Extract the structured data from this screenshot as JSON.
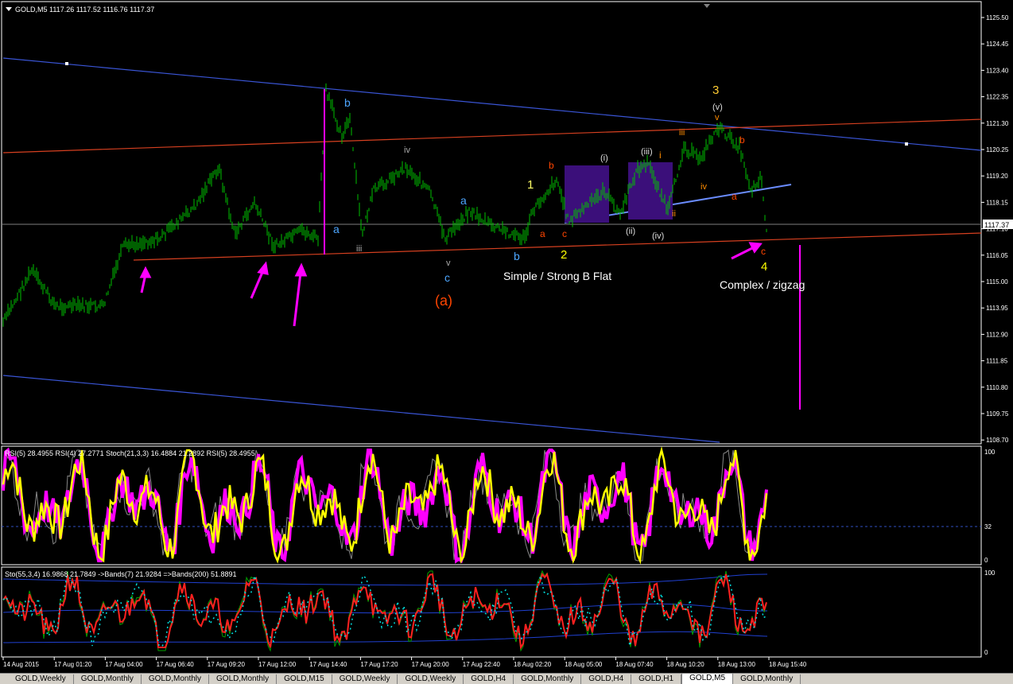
{
  "main_chart": {
    "title": "GOLD,M5  1117.26 1117.52 1116.76 1117.37",
    "current_price": "1117.37",
    "price_ticks": [
      "1125.50",
      "1124.45",
      "1123.40",
      "1122.35",
      "1121.30",
      "1120.25",
      "1119.20",
      "1118.15",
      "1117.10",
      "1116.05",
      "1115.00",
      "1113.95",
      "1112.90",
      "1111.85",
      "1110.80",
      "1109.75",
      "1108.70"
    ],
    "annotations": {
      "simple_flat": "Simple / Strong B Flat",
      "complex": "Complex / zigzag",
      "wave_a_main": "(a)",
      "w_b_top": "b",
      "w_a_left": "a",
      "w_iii_left": "iii",
      "w_iv_mid": "iv",
      "w_a_mid": "a",
      "w_v_low": "v",
      "w_c_low": "c",
      "w_b_low": "b",
      "w_1": "1",
      "w_b_red": "b",
      "w_a_red": "a",
      "w_c_red": "c",
      "w_2": "2",
      "w_i_paren": "(i)",
      "w_iii_paren": "(iii)",
      "w_i_red": "i",
      "w_ii_paren": "(ii)",
      "w_iv_paren": "(iv)",
      "w_ii_red": "ii",
      "w_3": "3",
      "w_v_paren": "(v)",
      "w_v_red": "v",
      "w_iii_red": "iii",
      "w_iv_red": "iv",
      "w_b_right": "b",
      "w_a_right": "a",
      "w_c_right": "c",
      "w_4": "4"
    }
  },
  "rsi_panel": {
    "title": "RSI(5) 28.4955  RSI(4) 27.2771  Stoch(21,3,3) 16.4884 21.2892  RSI(5) 28.4955",
    "ticks": [
      "100",
      "32",
      "0"
    ]
  },
  "sto_panel": {
    "title": "Sto(55,3,4) 16.9868 21.7849  ->Bands(7) 21.9284  =>Bands(200) 51.8891",
    "ticks": [
      "100",
      "0"
    ]
  },
  "time_axis": [
    "14 Aug 2015",
    "17 Aug 01:20",
    "17 Aug 04:00",
    "17 Aug 06:40",
    "17 Aug 09:20",
    "17 Aug 12:00",
    "17 Aug 14:40",
    "17 Aug 17:20",
    "17 Aug 20:00",
    "17 Aug 22:40",
    "18 Aug 02:20",
    "18 Aug 05:00",
    "18 Aug 07:40",
    "18 Aug 10:20",
    "18 Aug 13:00",
    "18 Aug 15:40"
  ],
  "tabs": [
    "GOLD,Weekly",
    "GOLD,Monthly",
    "GOLD,Monthly",
    "GOLD,Monthly",
    "GOLD,M15",
    "GOLD,Weekly",
    "GOLD,Weekly",
    "GOLD,H4",
    "GOLD,Monthly",
    "GOLD,H4",
    "GOLD,H1",
    "GOLD,M5",
    "GOLD,Monthly"
  ],
  "active_tab": "GOLD,M5",
  "colors": {
    "candles": "#00c000",
    "grid": "#ffffff",
    "accent_magenta": "#ff00ff",
    "rsi_line": "#ffff00",
    "wave_orange": "#ff8c00",
    "wave_blue": "#4da6ff",
    "channel_blue": "#3a55d6",
    "trend_red": "#d64020"
  }
}
